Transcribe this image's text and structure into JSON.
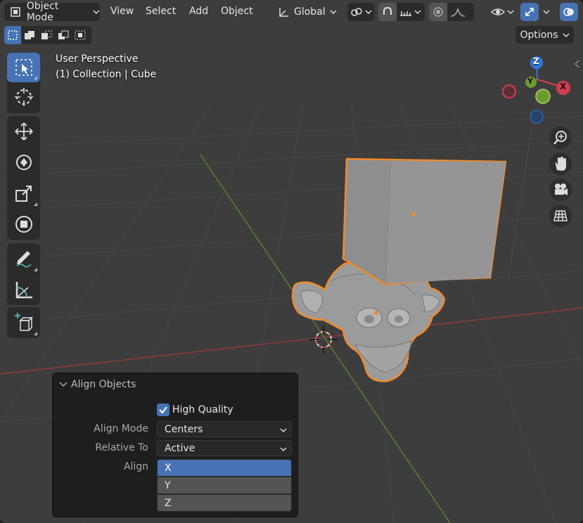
{
  "header": {
    "mode_label": "Object Mode",
    "menus": [
      "View",
      "Select",
      "Add",
      "Object"
    ],
    "orientation_label": "Global",
    "options_label": "Options"
  },
  "viewport": {
    "perspective_label": "User Perspective",
    "collection_label": "(1) Collection | Cube"
  },
  "gizmo": {
    "z_label": "Z",
    "y_label": "Y",
    "x_label": "X",
    "x_color": "#d23d4e",
    "y_color": "#6b9b2c",
    "z_color": "#2f79d9"
  },
  "toolbar": {
    "tools": [
      "select-box",
      "cursor",
      "move",
      "rotate",
      "scale",
      "transform",
      "annotate",
      "measure",
      "add-cube"
    ]
  },
  "align_panel": {
    "title": "Align Objects",
    "high_quality_label": "High Quality",
    "high_quality_checked": true,
    "align_mode_label": "Align Mode",
    "align_mode_value": "Centers",
    "relative_to_label": "Relative To",
    "relative_to_value": "Active",
    "align_label": "Align",
    "axes": [
      "X",
      "Y",
      "Z"
    ],
    "selected_axis": "X"
  },
  "colors": {
    "accent": "#4772b3",
    "selection_outline": "#f08a2c",
    "background": "#3d3d3d"
  }
}
